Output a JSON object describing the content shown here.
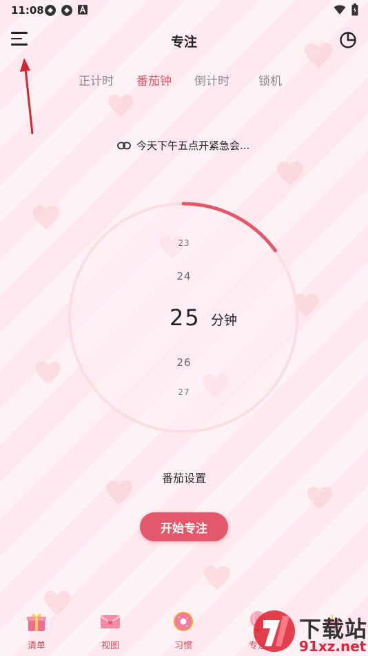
{
  "status_bar": {
    "time": "11:08",
    "icons": [
      "sync-icon",
      "sync-icon",
      "font-a-icon"
    ],
    "right_icons": [
      "wifi-icon",
      "battery-icon"
    ]
  },
  "header": {
    "title": "专注",
    "menu_icon": "hamburger-icon",
    "stats_icon": "pie-chart-icon"
  },
  "tabs": [
    {
      "label": "正计时",
      "active": false
    },
    {
      "label": "番茄钟",
      "active": true
    },
    {
      "label": "倒计时",
      "active": false
    },
    {
      "label": "锁机",
      "active": false
    }
  ],
  "linked_task": {
    "icon": "link-icon",
    "text": "今天下午五点开紧急会..."
  },
  "timer": {
    "progress": 0.15,
    "picker": {
      "items": [
        "23",
        "24",
        "25",
        "26",
        "27"
      ],
      "selected": "25",
      "unit": "分钟"
    }
  },
  "tomato_settings_label": "番茄设置",
  "start_button_label": "开始专注",
  "bottom_nav": [
    {
      "label": "清单",
      "icon": "gift-icon"
    },
    {
      "label": "视图",
      "icon": "envelope-icon"
    },
    {
      "label": "习惯",
      "icon": "donut-icon"
    },
    {
      "label": "专注",
      "icon": "balloon-icon"
    },
    {
      "label": "",
      "icon": "cake-icon"
    }
  ],
  "watermark": {
    "line1": "下载站",
    "line2": "91xz.net"
  },
  "colors": {
    "accent": "#e4586b",
    "ring_track": "#fbdde3",
    "tab_inactive": "#8a8a8a"
  }
}
